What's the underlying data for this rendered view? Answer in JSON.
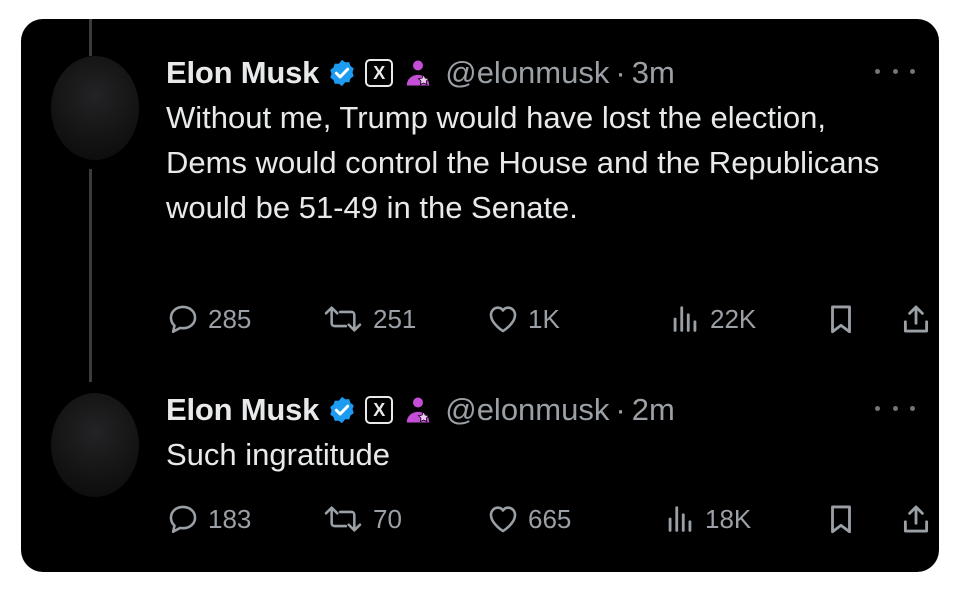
{
  "tweets": [
    {
      "author_name": "Elon Musk",
      "handle": "@elonmusk",
      "separator": "·",
      "time": "3m",
      "text": "Without me, Trump would have lost the election, Dems would control the House and the Republicans would be 51-49 in the Senate.",
      "badges": [
        "verified-badge-icon",
        "x-affiliate-badge-icon",
        "government-official-icon"
      ],
      "metrics": {
        "replies": "285",
        "reposts": "251",
        "likes": "1K",
        "views": "22K"
      }
    },
    {
      "author_name": "Elon Musk",
      "handle": "@elonmusk",
      "separator": "·",
      "time": "2m",
      "text": "Such ingratitude",
      "badges": [
        "verified-badge-icon",
        "x-affiliate-badge-icon",
        "government-official-icon"
      ],
      "metrics": {
        "replies": "183",
        "reposts": "70",
        "likes": "665",
        "views": "18K"
      }
    }
  ],
  "affiliate_badge_letter": "X",
  "colors": {
    "background": "#000000",
    "primary_text": "#e7e9ea",
    "secondary_text": "#9aa0a6",
    "verified_blue": "#1d9bf0",
    "government_purple": "#c44fd6"
  }
}
